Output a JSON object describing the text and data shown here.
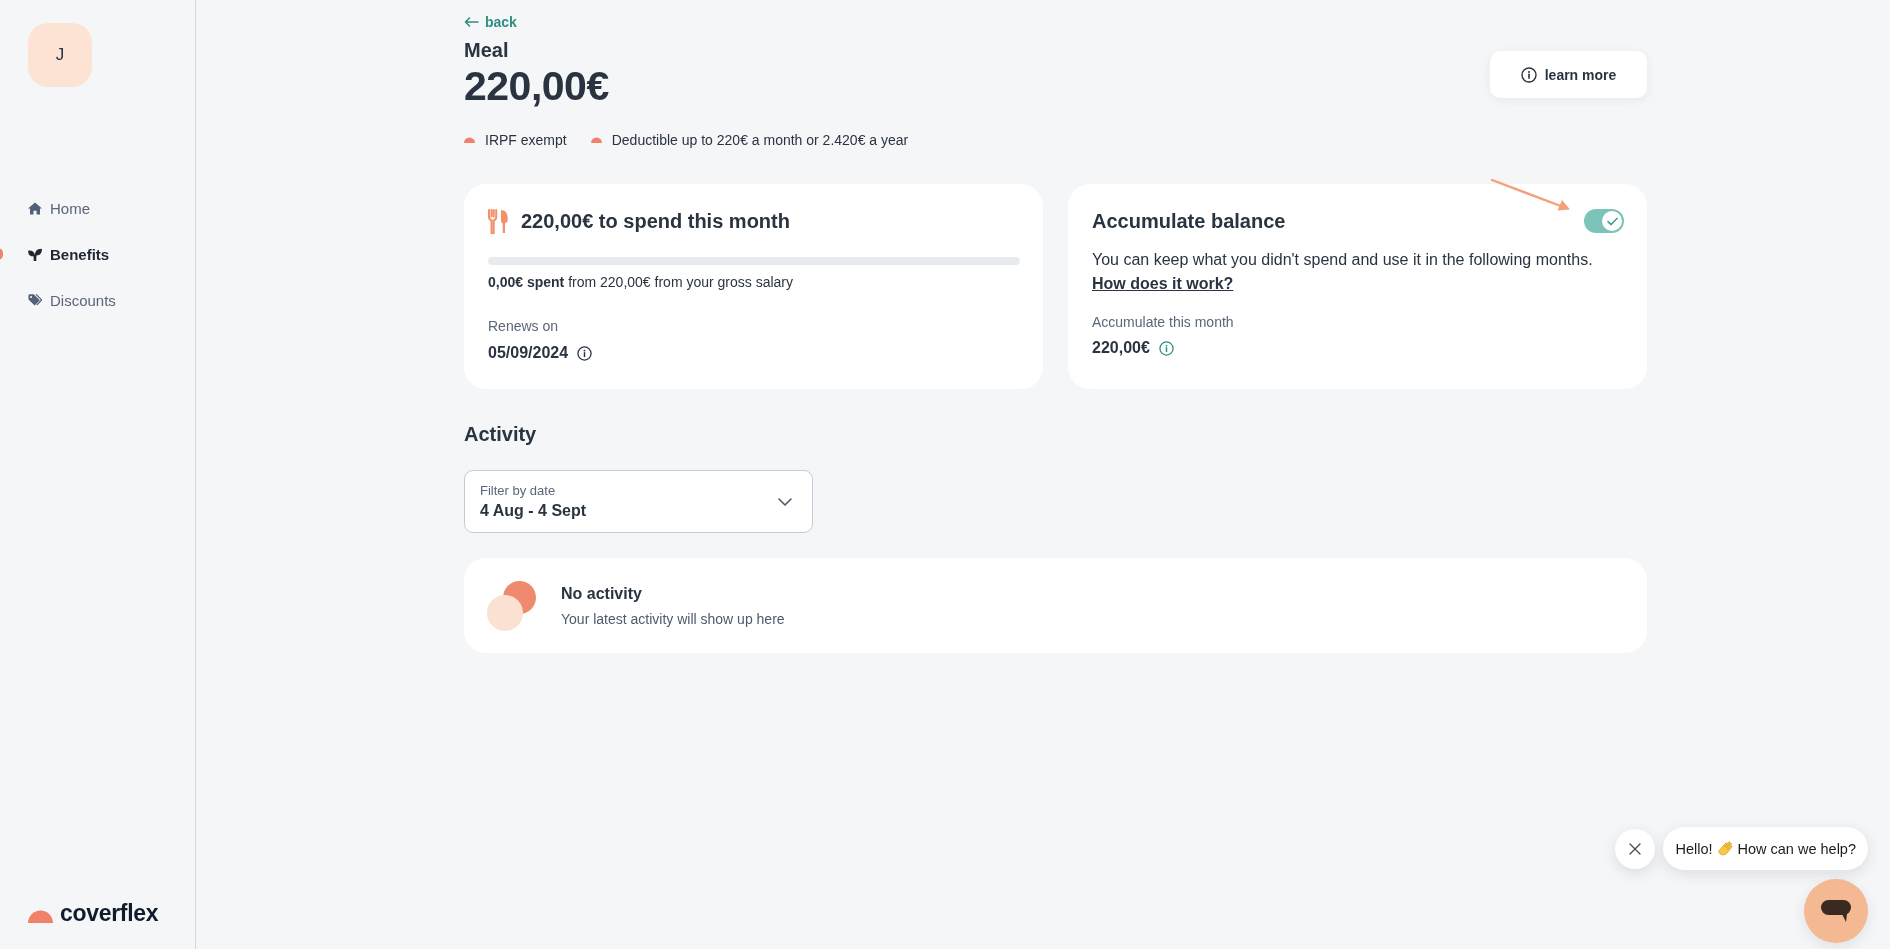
{
  "sidebar": {
    "avatar": {
      "initial": "J"
    },
    "nav": [
      {
        "label": "Home",
        "selected": false
      },
      {
        "label": "Benefits",
        "selected": true
      },
      {
        "label": "Discounts",
        "selected": false
      }
    ],
    "logo": {
      "text": "coverflex"
    }
  },
  "header": {
    "back": "back",
    "category": "Meal",
    "amount": "220,00€",
    "learn_more": "learn more",
    "tags": [
      "IRPF exempt",
      "Deductible up to 220€ a month or 2.420€ a year"
    ]
  },
  "spend_card": {
    "title": "220,00€ to spend this month",
    "spent": "**0,00€ spent** from 220,00€ from your gross salary",
    "renews_label": "Renews on",
    "renews_date": "05/09/2024"
  },
  "accumulate_card": {
    "title": "Accumulate balance",
    "toggle": {
      "on": true
    },
    "description": "You can keep what you didn't spend and use it in the following months.",
    "link": "How does it work?",
    "amount_label": "Accumulate this month",
    "amount": "220,00€"
  },
  "activity": {
    "title": "Activity",
    "filter": {
      "label": "Filter by date",
      "value": "4 Aug - 4 Sept"
    },
    "empty": {
      "title": "No activity",
      "subtitle": "Your latest activity will show up here"
    }
  },
  "chat": {
    "greeting_start": "Hello!",
    "greeting_end": "How can we help?"
  }
}
